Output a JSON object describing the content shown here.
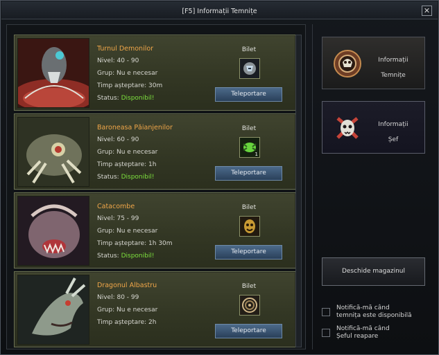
{
  "window": {
    "title": "[F5] Informații Temnițe",
    "close_glyph": "✕"
  },
  "dungeons": [
    {
      "name": "Turnul Demonilor",
      "level": "Nivel: 40 - 90",
      "group": "Grup: Nu e necesar",
      "wait": "Timp așteptare: 30m",
      "status_label": "Status: ",
      "status_value": "Disponibil!",
      "ticket_label": "Bilet",
      "ticket_icon": "helmet-ticket-icon",
      "ticket_count": "",
      "button_label": "Teleportare"
    },
    {
      "name": "Baroneasa Păianjenilor",
      "level": "Nivel: 60 - 90",
      "group": "Grup: Nu e necesar",
      "wait": "Timp așteptare: 1h",
      "status_label": "Status: ",
      "status_value": "Disponibil!",
      "ticket_label": "Bilet",
      "ticket_icon": "green-spider-ticket-icon",
      "ticket_count": "1",
      "button_label": "Teleportare"
    },
    {
      "name": "Catacombe",
      "level": "Nivel: 75 - 99",
      "group": "Grup: Nu e necesar",
      "wait": "Timp așteptare: 1h 30m",
      "status_label": "Status: ",
      "status_value": "Disponibil!",
      "ticket_label": "Bilet",
      "ticket_icon": "golden-mask-ticket-icon",
      "ticket_count": "",
      "button_label": "Teleportare"
    },
    {
      "name": "Dragonul Albastru",
      "level": "Nivel: 80 - 99",
      "group": "Grup: Nu e necesar",
      "wait": "Timp așteptare: 2h",
      "ticket_label": "Bilet",
      "ticket_icon": "spiral-ticket-icon",
      "ticket_count": "",
      "button_label": "Teleportare"
    }
  ],
  "side_menu": {
    "dungeon_info": {
      "line1": "Informații",
      "line2": "Temnițe",
      "icon": "dungeon-emblem-icon"
    },
    "boss_info": {
      "line1": "Informații",
      "line2": "Șef",
      "icon": "boss-skull-icon"
    },
    "shop_button": "Deschide magazinul",
    "notify_available_line1": "Notifică-mă când",
    "notify_available_line2": "temnița este disponibilă",
    "notify_boss_line1": "Notifică-mă când",
    "notify_boss_line2": "Șeful reapare"
  },
  "colors": {
    "accent_orange": "#f0a649",
    "status_green": "#7ee23e",
    "card_olive": "#3b3f2a",
    "button_blue": "#3b5573"
  }
}
